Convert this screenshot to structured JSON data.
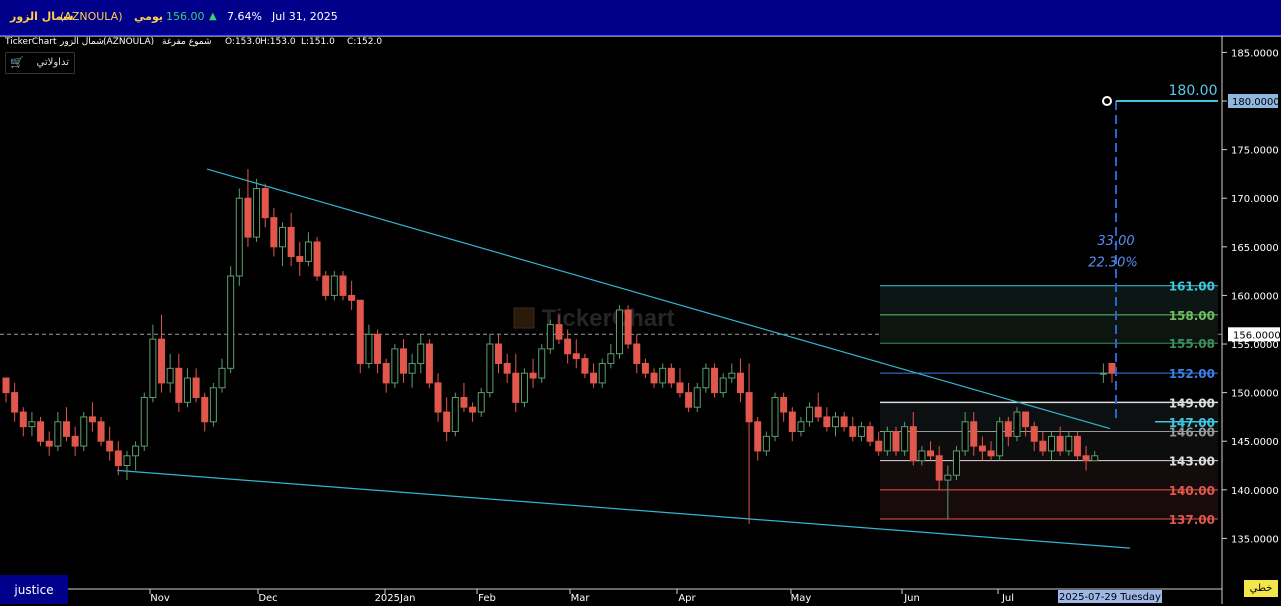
{
  "header": {
    "name": "شمال الزور",
    "symbol": "(AZNOULA)",
    "interval": "يومي",
    "price": "156.00",
    "change_pct": "7.64%",
    "date": "Jul 31, 2025"
  },
  "subheader": {
    "source": "TickerChart",
    "name": "شمال الزور",
    "symbol": "(AZNOULA)",
    "style": "شموع مفرغة",
    "open": "O:153.0",
    "high": "H:153.0",
    "low": "L:151.0",
    "close": "C:152.0"
  },
  "broker_label": "تداولاتي",
  "watermark": "TickerChart",
  "footer": {
    "left_label": "justice",
    "right_label": "خطي",
    "cursor_date": "2025-07-29 Tuesday"
  },
  "colors": {
    "up": "#5a9e6f",
    "down": "#e2574c",
    "trendline": "#30b6d0",
    "target_line": "#2a63d6",
    "header_bg": "#00008b"
  },
  "chart_data": {
    "type": "candlestick",
    "ylim": [
      133.5,
      189.5
    ],
    "y_ticks": [
      "185.0000",
      "180.0000",
      "175.0000",
      "170.0000",
      "165.0000",
      "160.0000",
      "155.0000",
      "150.0000",
      "145.0000",
      "140.0000",
      "135.0000"
    ],
    "x_ticks": [
      "Nov",
      "Dec",
      "2025Jan",
      "Feb",
      "Mar",
      "Apr",
      "May",
      "Jun",
      "Jul"
    ],
    "last_price": "156.0000",
    "current_value_label": "180.0000",
    "target": {
      "price_label": "180.00",
      "change": "33.00",
      "change_pct": "22.30%"
    },
    "levels": [
      {
        "value": 161.0,
        "label": "161.00",
        "color": "#3fc7e0"
      },
      {
        "value": 158.0,
        "label": "158.00",
        "color": "#6fbf62"
      },
      {
        "value": 155.08,
        "label": "155.08",
        "color": "#3a8f5a"
      },
      {
        "value": 152.0,
        "label": "152.00",
        "color": "#3a7ee8"
      },
      {
        "value": 149.0,
        "label": "149.00",
        "color": "#dddddd"
      },
      {
        "value": 147.0,
        "label": "147.00",
        "color": "#3fc7e0"
      },
      {
        "value": 146.0,
        "label": "146.00",
        "color": "#999999"
      },
      {
        "value": 143.0,
        "label": "143.00",
        "color": "#dddddd"
      },
      {
        "value": 140.0,
        "label": "140.00",
        "color": "#e2574c"
      },
      {
        "value": 137.0,
        "label": "137.00",
        "color": "#e2574c"
      }
    ],
    "series": [
      {
        "name": "OHLC",
        "values": [
          [
            151.5,
            151.5,
            149.0,
            150.0
          ],
          [
            150.0,
            151.0,
            147.0,
            148.0
          ],
          [
            148.0,
            148.5,
            145.5,
            146.5
          ],
          [
            146.5,
            148.0,
            145.5,
            147.0
          ],
          [
            147.0,
            147.5,
            144.5,
            145.0
          ],
          [
            145.0,
            146.0,
            143.5,
            144.5
          ],
          [
            144.5,
            148.0,
            144.0,
            147.0
          ],
          [
            147.0,
            148.5,
            145.0,
            145.5
          ],
          [
            145.5,
            146.5,
            143.5,
            144.5
          ],
          [
            144.5,
            148.0,
            144.0,
            147.5
          ],
          [
            147.5,
            149.0,
            146.0,
            147.0
          ],
          [
            147.0,
            147.5,
            144.5,
            145.0
          ],
          [
            145.0,
            146.5,
            143.0,
            144.0
          ],
          [
            144.0,
            145.0,
            141.5,
            142.5
          ],
          [
            142.5,
            144.0,
            141.0,
            143.5
          ],
          [
            143.5,
            145.0,
            142.0,
            144.5
          ],
          [
            144.5,
            150.0,
            144.0,
            149.5
          ],
          [
            149.5,
            157.0,
            149.0,
            155.5
          ],
          [
            155.5,
            158.0,
            150.0,
            151.0
          ],
          [
            151.0,
            154.0,
            150.0,
            152.5
          ],
          [
            152.5,
            154.0,
            148.0,
            149.0
          ],
          [
            149.0,
            152.5,
            148.5,
            151.5
          ],
          [
            151.5,
            152.5,
            149.0,
            149.5
          ],
          [
            149.5,
            150.0,
            146.0,
            147.0
          ],
          [
            147.0,
            151.0,
            146.5,
            150.5
          ],
          [
            150.5,
            153.5,
            150.0,
            152.5
          ],
          [
            152.5,
            163.0,
            152.0,
            162.0
          ],
          [
            162.0,
            171.0,
            161.0,
            170.0
          ],
          [
            170.0,
            173.0,
            165.0,
            166.0
          ],
          [
            166.0,
            172.0,
            165.5,
            171.0
          ],
          [
            171.0,
            171.5,
            167.0,
            168.0
          ],
          [
            168.0,
            169.0,
            164.0,
            165.0
          ],
          [
            165.0,
            167.5,
            163.0,
            167.0
          ],
          [
            167.0,
            168.5,
            163.0,
            164.0
          ],
          [
            164.0,
            165.5,
            162.0,
            163.5
          ],
          [
            163.5,
            166.5,
            163.0,
            165.5
          ],
          [
            165.5,
            166.0,
            161.5,
            162.0
          ],
          [
            162.0,
            162.5,
            159.5,
            160.0
          ],
          [
            160.0,
            162.5,
            159.5,
            162.0
          ],
          [
            162.0,
            162.5,
            159.5,
            160.0
          ],
          [
            160.0,
            161.5,
            158.5,
            159.5
          ],
          [
            159.5,
            156.5,
            152.0,
            153.0
          ],
          [
            153.0,
            157.0,
            152.5,
            156.0
          ],
          [
            156.0,
            156.5,
            152.0,
            153.0
          ],
          [
            153.0,
            153.5,
            150.0,
            151.0
          ],
          [
            151.0,
            155.0,
            150.5,
            154.5
          ],
          [
            154.5,
            155.5,
            151.0,
            152.0
          ],
          [
            152.0,
            154.0,
            150.5,
            153.0
          ],
          [
            153.0,
            156.0,
            152.0,
            155.0
          ],
          [
            155.0,
            155.5,
            150.5,
            151.0
          ],
          [
            151.0,
            152.0,
            147.0,
            148.0
          ],
          [
            148.0,
            149.5,
            145.0,
            146.0
          ],
          [
            146.0,
            150.0,
            145.5,
            149.5
          ],
          [
            149.5,
            151.0,
            148.0,
            148.5
          ],
          [
            148.5,
            149.0,
            147.0,
            148.0
          ],
          [
            148.0,
            150.5,
            147.5,
            150.0
          ],
          [
            150.0,
            156.0,
            149.5,
            155.0
          ],
          [
            155.0,
            156.0,
            152.0,
            153.0
          ],
          [
            153.0,
            154.0,
            151.0,
            152.0
          ],
          [
            152.0,
            154.0,
            148.0,
            149.0
          ],
          [
            149.0,
            152.5,
            148.5,
            152.0
          ],
          [
            152.0,
            153.5,
            150.5,
            151.5
          ],
          [
            151.5,
            155.0,
            151.0,
            154.5
          ],
          [
            154.5,
            157.5,
            154.0,
            157.0
          ],
          [
            157.0,
            158.0,
            155.0,
            155.5
          ],
          [
            155.5,
            156.5,
            153.0,
            154.0
          ],
          [
            154.0,
            155.5,
            152.5,
            153.5
          ],
          [
            153.5,
            154.0,
            151.5,
            152.0
          ],
          [
            152.0,
            153.0,
            150.5,
            151.0
          ],
          [
            151.0,
            153.5,
            150.5,
            153.0
          ],
          [
            153.0,
            155.0,
            152.5,
            154.0
          ],
          [
            154.0,
            159.0,
            153.5,
            158.5
          ],
          [
            158.5,
            159.0,
            154.5,
            155.0
          ],
          [
            155.0,
            156.0,
            152.0,
            153.0
          ],
          [
            153.0,
            153.5,
            151.5,
            152.0
          ],
          [
            152.0,
            152.5,
            150.5,
            151.0
          ],
          [
            151.0,
            153.0,
            150.5,
            152.5
          ],
          [
            152.5,
            153.0,
            150.5,
            151.0
          ],
          [
            151.0,
            152.5,
            149.5,
            150.0
          ],
          [
            150.0,
            151.0,
            148.0,
            148.5
          ],
          [
            148.5,
            151.0,
            148.0,
            150.5
          ],
          [
            150.5,
            153.0,
            150.0,
            152.5
          ],
          [
            152.5,
            153.0,
            149.5,
            150.0
          ],
          [
            150.0,
            152.0,
            149.5,
            151.5
          ],
          [
            151.5,
            153.0,
            151.0,
            152.0
          ],
          [
            152.0,
            153.5,
            149.0,
            150.0
          ],
          [
            150.0,
            153.0,
            136.5,
            147.0
          ],
          [
            147.0,
            147.5,
            143.0,
            144.0
          ],
          [
            144.0,
            146.0,
            143.5,
            145.5
          ],
          [
            145.5,
            150.0,
            145.0,
            149.5
          ],
          [
            149.5,
            150.0,
            147.0,
            148.0
          ],
          [
            148.0,
            148.5,
            145.0,
            146.0
          ],
          [
            146.0,
            147.5,
            145.5,
            147.0
          ],
          [
            147.0,
            149.0,
            146.5,
            148.5
          ],
          [
            148.5,
            150.0,
            147.0,
            147.5
          ],
          [
            147.5,
            148.5,
            146.0,
            146.5
          ],
          [
            146.5,
            148.0,
            145.5,
            147.5
          ],
          [
            147.5,
            148.0,
            146.0,
            146.5
          ],
          [
            146.5,
            147.5,
            145.0,
            145.5
          ],
          [
            145.5,
            147.0,
            145.0,
            146.5
          ],
          [
            146.5,
            147.0,
            144.5,
            145.0
          ],
          [
            145.0,
            146.0,
            143.5,
            144.0
          ],
          [
            144.0,
            146.5,
            143.5,
            146.0
          ],
          [
            146.0,
            146.5,
            143.5,
            144.0
          ],
          [
            144.0,
            147.0,
            143.5,
            146.5
          ],
          [
            146.5,
            148.0,
            142.5,
            143.0
          ],
          [
            143.0,
            144.5,
            142.5,
            144.0
          ],
          [
            144.0,
            145.0,
            143.0,
            143.5
          ],
          [
            143.5,
            144.5,
            140.0,
            141.0
          ],
          [
            141.0,
            142.5,
            137.0,
            141.5
          ],
          [
            141.5,
            144.5,
            141.0,
            144.0
          ],
          [
            144.0,
            148.0,
            143.5,
            147.0
          ],
          [
            147.0,
            148.0,
            143.5,
            144.5
          ],
          [
            144.5,
            145.5,
            143.0,
            144.0
          ],
          [
            144.0,
            145.0,
            143.0,
            143.5
          ],
          [
            143.5,
            147.5,
            143.0,
            147.0
          ],
          [
            147.0,
            147.5,
            144.5,
            145.5
          ],
          [
            145.5,
            148.5,
            145.0,
            148.0
          ],
          [
            148.0,
            148.0,
            145.5,
            146.5
          ],
          [
            146.5,
            147.0,
            144.0,
            145.0
          ],
          [
            145.0,
            146.0,
            143.5,
            144.0
          ],
          [
            144.0,
            146.0,
            143.0,
            145.5
          ],
          [
            145.5,
            146.5,
            143.5,
            144.0
          ],
          [
            144.0,
            146.0,
            143.5,
            145.5
          ],
          [
            145.5,
            146.0,
            143.0,
            143.5
          ],
          [
            143.5,
            144.5,
            142.0,
            143.0
          ],
          [
            143.0,
            144.0,
            143.0,
            143.5
          ],
          [
            152.0,
            153.0,
            151.0,
            152.0
          ],
          [
            153.0,
            153.0,
            151.0,
            152.0
          ]
        ]
      }
    ]
  }
}
